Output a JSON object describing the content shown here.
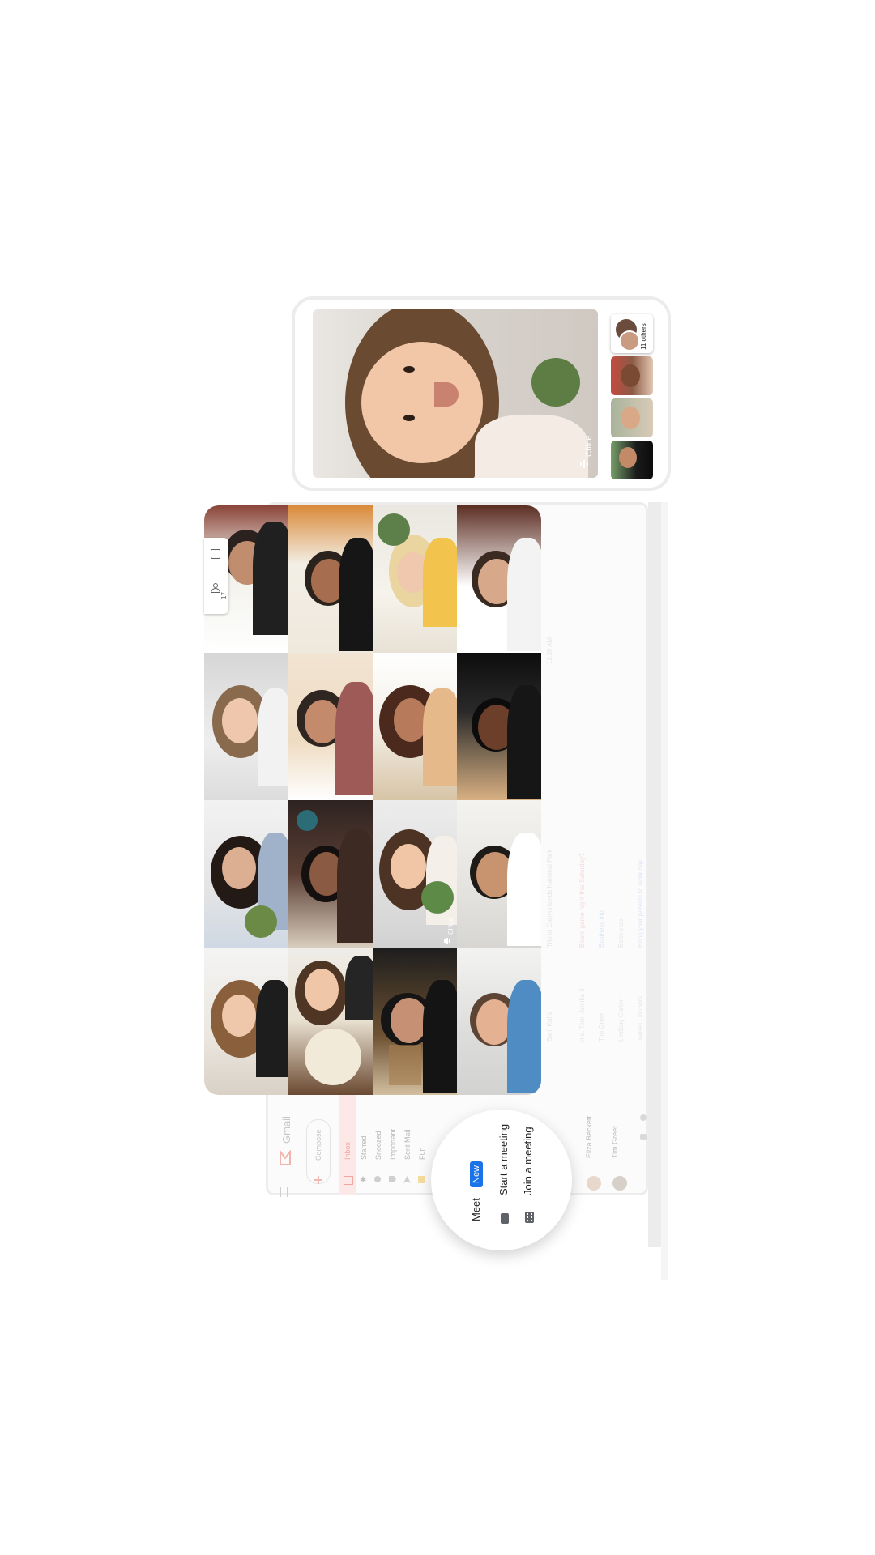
{
  "gmail": {
    "brand": "Gmail",
    "compose_label": "Compose",
    "nav": [
      "Inbox",
      "Starred",
      "Snoozed",
      "Important",
      "Sent Mail",
      "Fun"
    ],
    "contacts": [
      {
        "name": "Eliza Beckett"
      },
      {
        "name": "Tim Greer"
      }
    ],
    "rows": [
      {
        "sender": "Sarif Kuffs",
        "subject": "Trip to Canyonlands National Park"
      },
      {
        "sender": "me, Tom, Annika 3",
        "subject": "Board game night this Saturday?"
      },
      {
        "sender": "Tim Greer",
        "subject": "Business trip"
      },
      {
        "sender": "Lindsay Carter",
        "subject": "Book club"
      },
      {
        "sender": "James Connors",
        "subject": "Bring your parents to work day"
      }
    ],
    "time_label": "11:30 AM"
  },
  "grid": {
    "active_label": "Chloe",
    "participants_count": "17"
  },
  "pip": {
    "speaker_label": "Chloe",
    "others_label": "11 others"
  },
  "meet": {
    "title": "Meet",
    "new_badge": "New",
    "start_label": "Start a meeting",
    "join_label": "Join a meeting"
  },
  "colors": {
    "accent_blue": "#1a73e8",
    "active_speaker": "#33c3a6",
    "gmail_red": "#ea4335"
  },
  "icons": [
    "menu-icon",
    "gmail-logo-icon",
    "compose-plus-icon",
    "inbox-icon",
    "star-icon",
    "snooze-icon",
    "important-icon",
    "send-icon",
    "label-icon",
    "people-icon",
    "chat-icon",
    "video-camera-icon",
    "keyboard-icon",
    "mic-active-icon"
  ]
}
